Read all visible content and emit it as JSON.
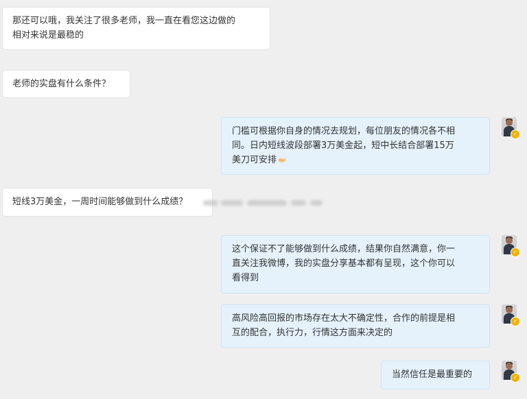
{
  "conversation": {
    "messages": [
      {
        "sender": "user",
        "lines": [
          "那还可以哦，我关注了很多老师，我一直在看您这边做的",
          "相对来说是最稳的"
        ]
      },
      {
        "sender": "user",
        "lines": [
          "老师的实盘有什么条件？"
        ]
      },
      {
        "sender": "teacher",
        "lines": [
          "门槛可根据你自身的情况去规划，每位朋友的情况各不相",
          "同。日内短线波段部署3万美金起，短中长结合部署15万",
          "美刀可安排"
        ],
        "emoji": "handshake-emoji"
      },
      {
        "sender": "user",
        "lines": [
          "短线3万美金，一周时间能够做到什么成绩？"
        ]
      },
      {
        "sender": "teacher",
        "lines": [
          "这个保证不了能够做到什么成绩，结果你自然满意，你一",
          "直关注我微博，我的实盘分享基本都有呈现，这个你可以",
          "看得到"
        ]
      },
      {
        "sender": "teacher",
        "lines": [
          "高风险高回报的市场存在太大不确定性，合作的前提是相",
          "互的配合，执行力，行情这方面来决定的"
        ]
      },
      {
        "sender": "teacher",
        "lines": [
          "当然信任是最重要的"
        ]
      }
    ]
  },
  "colors": {
    "page_background": "#efefef",
    "incoming_bubble": "#ffffff",
    "outgoing_bubble": "#e5f2fc",
    "text": "#333333",
    "verified_badge": "#f2b100"
  },
  "icons": {
    "avatar": "teacher-avatar",
    "badge": "verified-badge-icon",
    "emoji": "handshake-emoji"
  }
}
